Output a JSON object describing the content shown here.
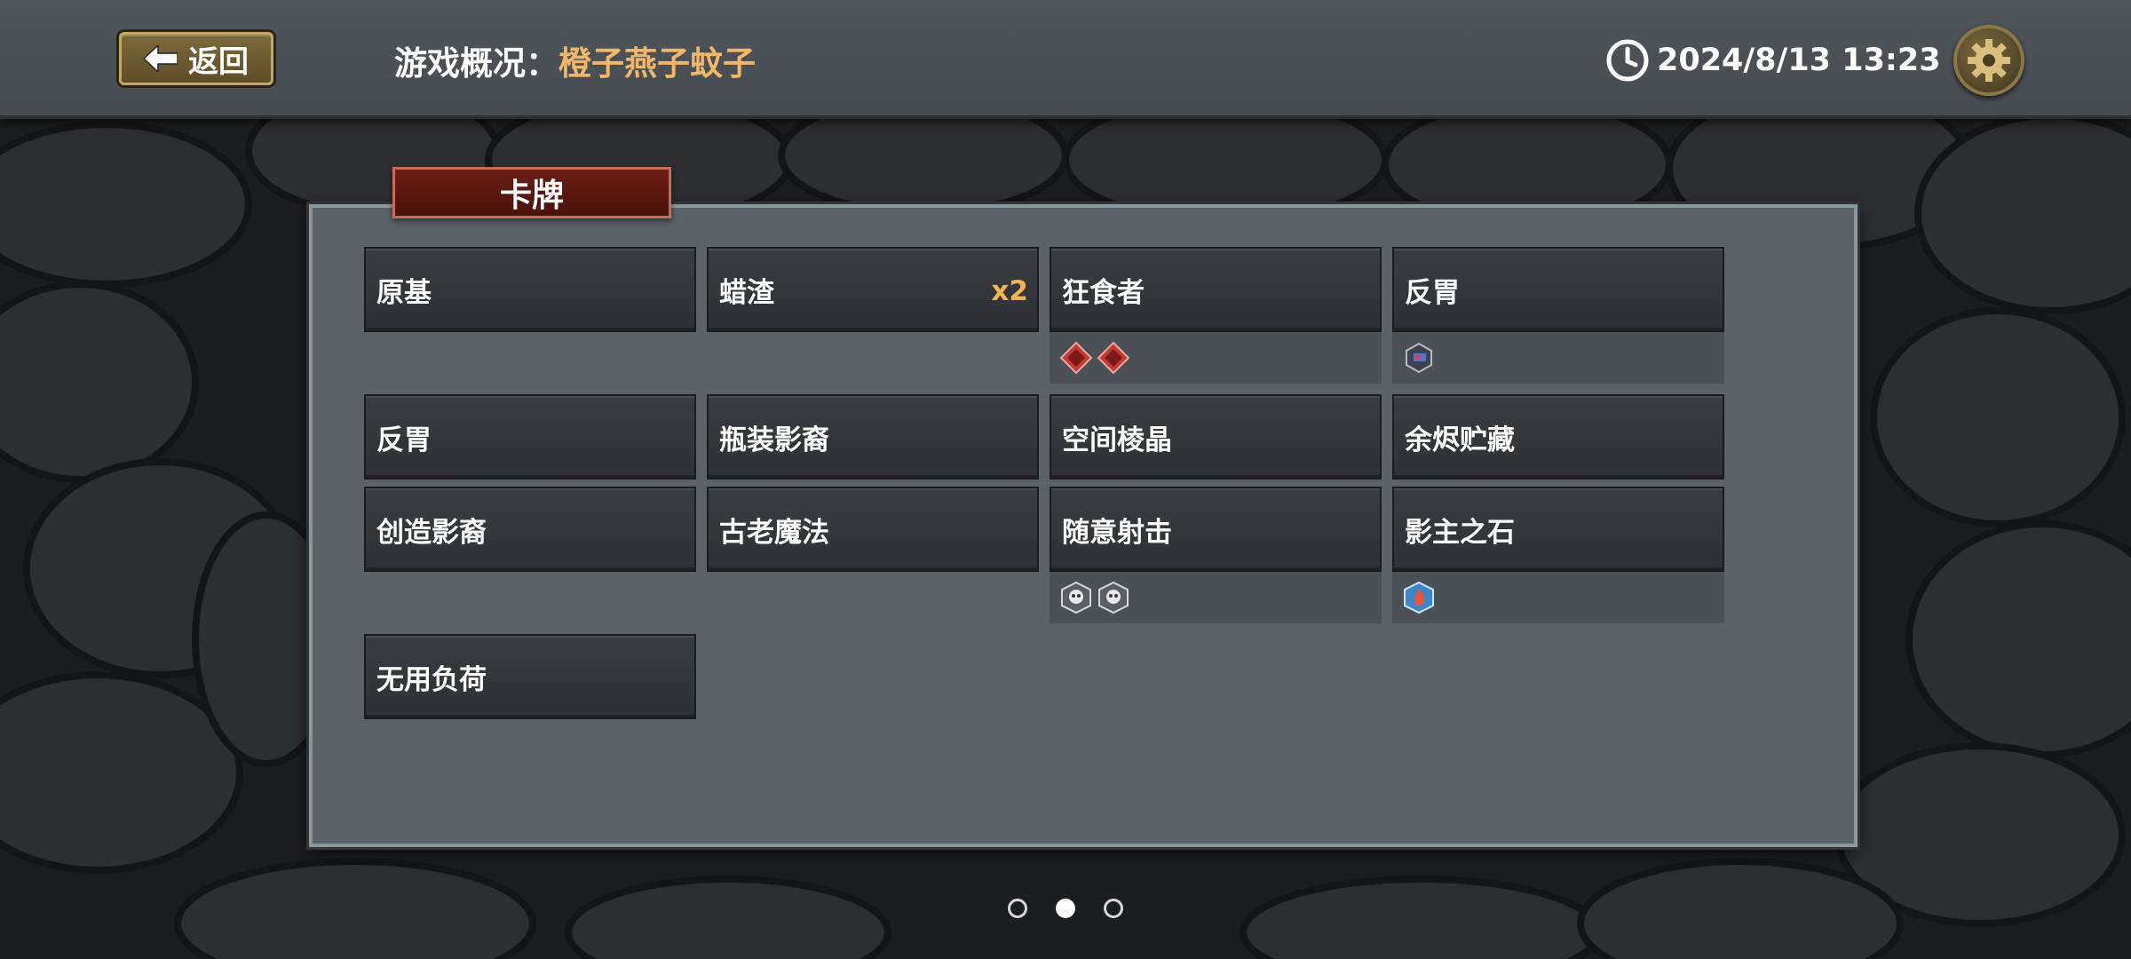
{
  "header": {
    "back_label": "返回",
    "title_label": "游戏概况：",
    "title_value": "橙子燕子蚊子",
    "datetime": "2024/8/13 13:23"
  },
  "panel": {
    "tab_label": "卡牌",
    "cards": [
      {
        "name": "原基",
        "count": ""
      },
      {
        "name": "蜡渣",
        "count": "x2"
      },
      {
        "name": "狂食者",
        "count": "",
        "extras": [
          "red-rune-icon",
          "red-rune-icon"
        ]
      },
      {
        "name": "反胃",
        "count": "",
        "extras": [
          "blue-crest-icon"
        ]
      },
      {
        "name": "反胃",
        "count": ""
      },
      {
        "name": "瓶装影裔",
        "count": ""
      },
      {
        "name": "空间棱晶",
        "count": ""
      },
      {
        "name": "余烬贮藏",
        "count": ""
      },
      {
        "name": "创造影裔",
        "count": ""
      },
      {
        "name": "古老魔法",
        "count": ""
      },
      {
        "name": "随意射击",
        "count": "",
        "extras": [
          "skull-crest-icon",
          "skull-crest-icon"
        ]
      },
      {
        "name": "影主之石",
        "count": "",
        "extras": [
          "flame-crest-icon"
        ]
      },
      {
        "name": "无用负荷",
        "count": ""
      }
    ]
  },
  "pager": {
    "pages": 3,
    "active_index": 1
  }
}
